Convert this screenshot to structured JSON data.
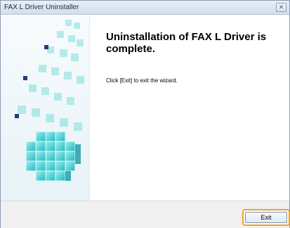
{
  "window": {
    "title": "FAX L Driver Uninstaller",
    "close_glyph": "✕"
  },
  "content": {
    "headline": "Uninstallation of FAX L Driver is complete.",
    "instruction": "Click [Exit] to exit the wizard."
  },
  "footer": {
    "exit_label": "Exit"
  },
  "colors": {
    "accent_orange": "#f0a030",
    "cube_teal": "#2ec8c8",
    "cube_dark": "#1a7f8f"
  },
  "icons": [
    "close-icon",
    "cube-illustration"
  ]
}
